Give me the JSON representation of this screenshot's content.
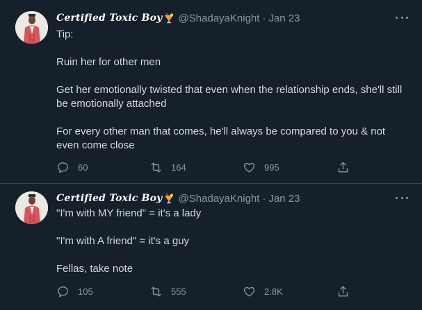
{
  "colors": {
    "background": "#15202b",
    "divider": "#38444d",
    "muted": "#8899a6",
    "text": "#d9d9d9"
  },
  "tweets": [
    {
      "author": "Certified Toxic Boy",
      "handle": "@ShadayaKnight",
      "separator": "·",
      "date": "Jan 23",
      "lines": [
        "Tip:",
        "",
        "Ruin her for other men",
        "",
        "Get her emotionally twisted that even when the relationship ends, she'll still",
        "be emotionally attached",
        "",
        "For every other man that comes, he'll always be compared to you & not",
        "even come close"
      ],
      "replies": "60",
      "retweets": "164",
      "likes": "995",
      "icons": [
        "reply-icon",
        "retweet-icon",
        "like-icon",
        "share-icon",
        "more-icon",
        "tropical-drink-emoji"
      ]
    },
    {
      "author": "Certified Toxic Boy",
      "handle": "@ShadayaKnight",
      "separator": "·",
      "date": "Jan 23",
      "lines": [
        "\"I'm with MY friend\" = it's a lady",
        "",
        "\"I'm with A friend\" = it's a guy",
        "",
        "Fellas, take note"
      ],
      "replies": "105",
      "retweets": "555",
      "likes": "2.8K",
      "icons": [
        "reply-icon",
        "retweet-icon",
        "like-icon",
        "share-icon",
        "more-icon",
        "tropical-drink-emoji"
      ]
    }
  ]
}
